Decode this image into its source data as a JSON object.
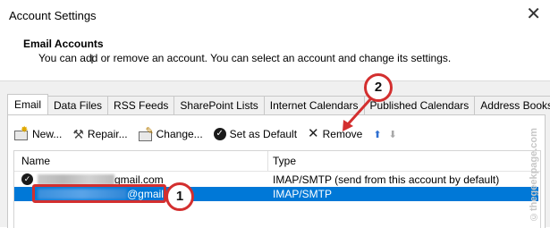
{
  "window": {
    "title": "Account Settings",
    "close_glyph": "✕"
  },
  "header": {
    "section_title": "Email Accounts",
    "description": "You can add or remove an account. You can select an account and change its settings."
  },
  "tabs": [
    {
      "label": "Email",
      "active": true
    },
    {
      "label": "Data Files",
      "active": false
    },
    {
      "label": "RSS Feeds",
      "active": false
    },
    {
      "label": "SharePoint Lists",
      "active": false
    },
    {
      "label": "Internet Calendars",
      "active": false
    },
    {
      "label": "Published Calendars",
      "active": false
    },
    {
      "label": "Address Books",
      "active": false
    }
  ],
  "toolbar": {
    "new_label": "New...",
    "repair_label": "Repair...",
    "change_label": "Change...",
    "set_default_label": "Set as Default",
    "remove_label": "Remove",
    "move_up_glyph": "⬆",
    "move_down_glyph": "⬇"
  },
  "list": {
    "columns": {
      "name": "Name",
      "type": "Type"
    },
    "rows": [
      {
        "name_suffix": "gmail.com",
        "type": "IMAP/SMTP (send from this account by default)",
        "is_default": true,
        "selected": false
      },
      {
        "name_suffix": "@gmail.com",
        "type": "IMAP/SMTP",
        "is_default": false,
        "selected": true
      }
    ]
  },
  "annotations": {
    "badge1": "1",
    "badge2": "2",
    "color": "#d32f2f"
  },
  "watermark": "©thegeekpage.com",
  "colors": {
    "selection": "#0078d7",
    "move_up": "#2e6fd1"
  }
}
